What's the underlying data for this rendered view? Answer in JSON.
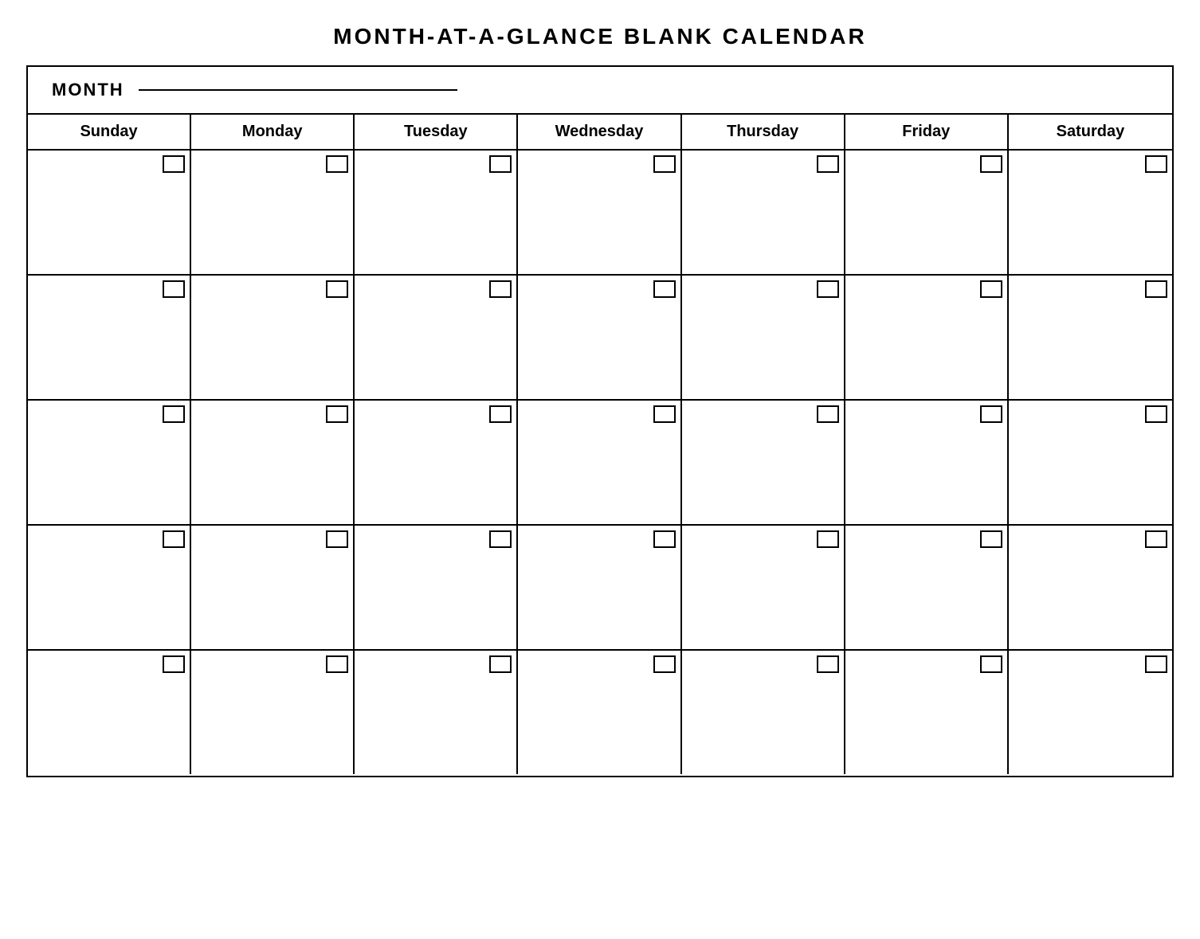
{
  "title": "MONTH-AT-A-GLANCE  BLANK  CALENDAR",
  "month_label": "MONTH",
  "days": [
    "Sunday",
    "Monday",
    "Tuesday",
    "Wednesday",
    "Thursday",
    "Friday",
    "Saturday"
  ],
  "rows": 5,
  "cols": 7
}
